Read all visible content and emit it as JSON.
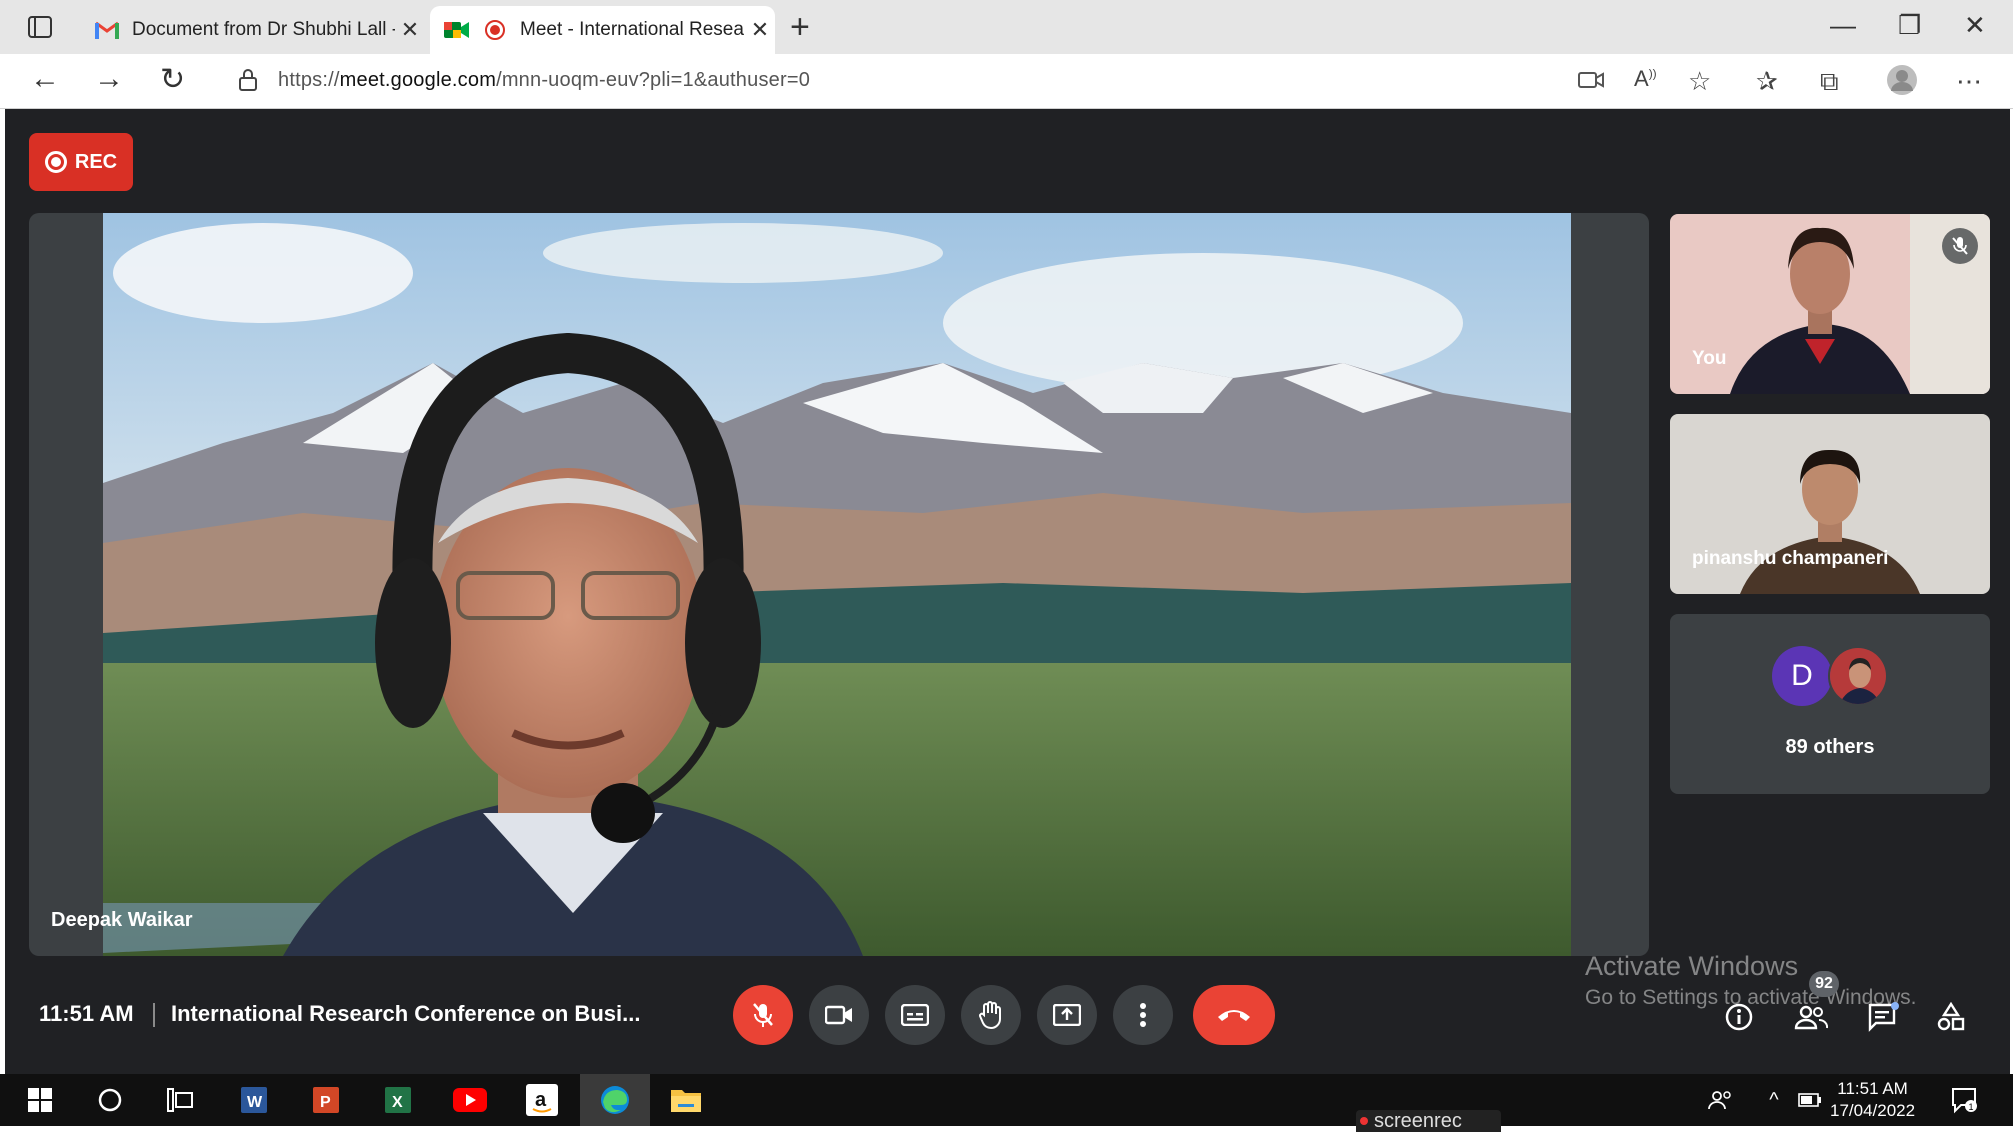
{
  "browser": {
    "tabs": [
      {
        "label": "Document from Dr Shubhi Lall -",
        "icon": "gmail-icon"
      },
      {
        "label": "Meet - International Researc",
        "icon": "meet-icon",
        "active": true
      }
    ],
    "url_prefix": "https://",
    "url_host": "meet.google.com",
    "url_path": "/mnn-uoqm-euv?pli=1&authuser=0"
  },
  "meet": {
    "rec_label": "REC",
    "main_speaker": "Deepak Waikar",
    "tiles": {
      "self_label": "You",
      "participant_label": "pinanshu champaneri",
      "others_avatar_letter": "D",
      "others_label": "89 others"
    },
    "bottom": {
      "time": "11:51 AM",
      "meeting_title": "International Research Conference on Busi...",
      "people_count": "92"
    },
    "colors": {
      "accent_red": "#ea4335",
      "background": "#202124",
      "tile": "#3c4043"
    }
  },
  "watermark": {
    "line1": "Activate Windows",
    "line2": "Go to Settings to activate Windows."
  },
  "taskbar": {
    "time": "11:51 AM",
    "date": "17/04/2022",
    "screenrec_label": "screenrec"
  }
}
